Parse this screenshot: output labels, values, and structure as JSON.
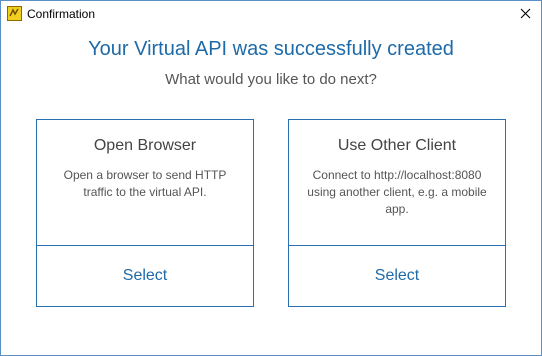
{
  "window": {
    "title": "Confirmation"
  },
  "icons": {
    "app": "app-logo-icon",
    "close": "close-icon"
  },
  "heading": "Your Virtual API was successfully created",
  "subheading": "What would you like to do next?",
  "cards": [
    {
      "title": "Open Browser",
      "description": "Open a browser to send HTTP traffic to the virtual API.",
      "select_label": "Select"
    },
    {
      "title": "Use Other Client",
      "description": "Connect to http://localhost:8080 using another client, e.g. a mobile app.",
      "select_label": "Select"
    }
  ],
  "colors": {
    "accent": "#1e6aa8",
    "border": "#2a6fb0",
    "icon": "#f2cf1f"
  }
}
